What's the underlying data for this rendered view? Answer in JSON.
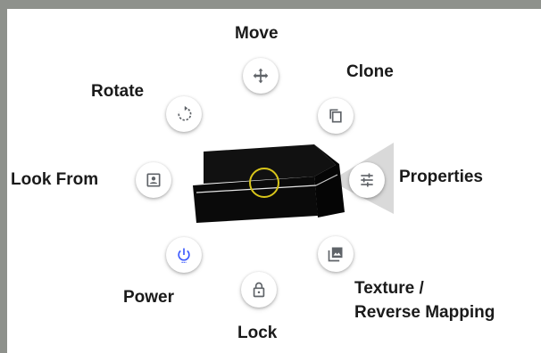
{
  "menu": {
    "move": {
      "label": "Move",
      "icon": "move-arrows-icon"
    },
    "clone": {
      "label": "Clone",
      "icon": "copy-icon"
    },
    "rotate": {
      "label": "Rotate",
      "icon": "rotate-icon"
    },
    "look_from": {
      "label": "Look From",
      "icon": "portrait-icon"
    },
    "properties": {
      "label": "Properties",
      "icon": "sliders-icon"
    },
    "power": {
      "label": "Power",
      "icon": "power-icon",
      "color": "#3d5afe"
    },
    "lock": {
      "label": "Lock",
      "icon": "lock-icon"
    },
    "texture": {
      "label_line1": "Texture /",
      "label_line2": "Reverse Mapping",
      "icon": "image-icon"
    }
  },
  "colors": {
    "frame": "#8e918c",
    "object": "#0a0a0a",
    "target_ring": "#d8c51a",
    "icon": "#5f6368",
    "power_accent": "#3d5afe"
  }
}
